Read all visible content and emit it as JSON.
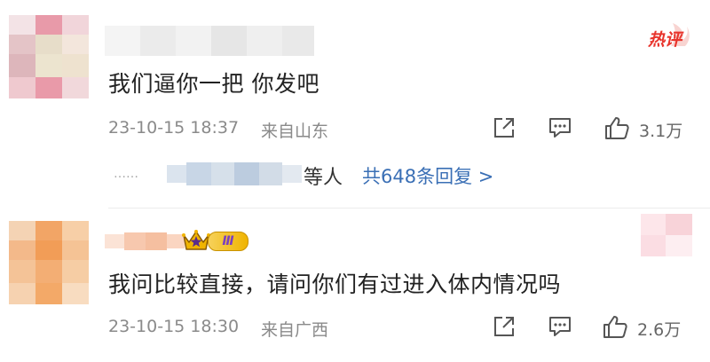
{
  "comments": [
    {
      "hot_badge": "热评",
      "text": "我们逼你一把 你发吧",
      "timestamp": "23-10-15 18:37",
      "location": "来自山东",
      "like_count": "3.1万",
      "replies": {
        "suffix": "等人",
        "link": "共648条回复 >"
      }
    },
    {
      "badge_level": "Ⅲ",
      "text": "我问比较直接，请问你们有过进入体内情况吗",
      "timestamp": "23-10-15 18:30",
      "location": "来自广西",
      "like_count": "2.6万"
    }
  ],
  "icons": {
    "share": "share-icon",
    "comment": "comment-icon",
    "like": "thumbs-up-icon",
    "crown": "crown-icon"
  },
  "colors": {
    "hot_badge": "#e8342c",
    "link": "#3a6fb5",
    "meta": "#8a8a8a",
    "vip_gold": "#f0b400",
    "vip_purple": "#7a3fc0"
  }
}
